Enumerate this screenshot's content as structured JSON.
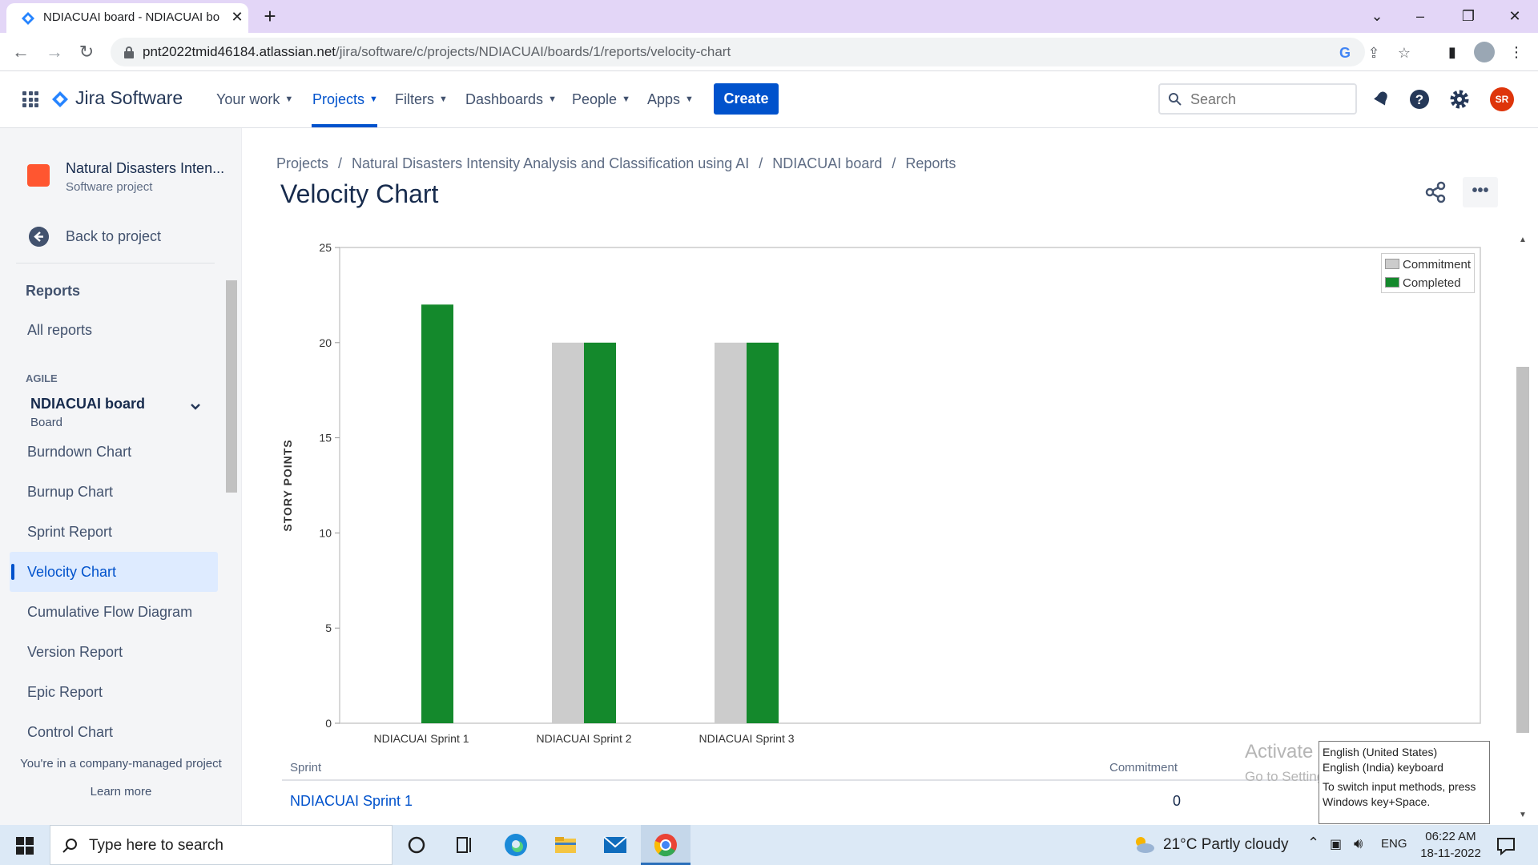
{
  "browser": {
    "tab_title": "NDIACUAI board - NDIACUAI bo",
    "url_host": "pnt2022tmid46184.atlassian.net",
    "url_path": "/jira/software/c/projects/NDIACUAI/boards/1/reports/velocity-chart"
  },
  "topnav": {
    "product": "Jira Software",
    "items": [
      {
        "label": "Your work"
      },
      {
        "label": "Projects"
      },
      {
        "label": "Filters"
      },
      {
        "label": "Dashboards"
      },
      {
        "label": "People"
      },
      {
        "label": "Apps"
      }
    ],
    "create_label": "Create",
    "search_placeholder": "Search",
    "avatar_initials": "SR"
  },
  "sidebar": {
    "project_name": "Natural Disasters Inten...",
    "project_type": "Software project",
    "back_label": "Back to project",
    "reports_heading": "Reports",
    "all_reports": "All reports",
    "agile_label": "AGILE",
    "board_name": "NDIACUAI board",
    "board_type": "Board",
    "links": [
      {
        "label": "Burndown Chart"
      },
      {
        "label": "Burnup Chart"
      },
      {
        "label": "Sprint Report"
      },
      {
        "label": "Velocity Chart"
      },
      {
        "label": "Cumulative Flow Diagram"
      },
      {
        "label": "Version Report"
      },
      {
        "label": "Epic Report"
      },
      {
        "label": "Control Chart"
      }
    ],
    "footer_text": "You're in a company-managed project",
    "learn_more": "Learn more"
  },
  "breadcrumb": [
    "Projects",
    "Natural Disasters Intensity Analysis and Classification using AI",
    "NDIACUAI board",
    "Reports"
  ],
  "page_title": "Velocity Chart",
  "chart_data": {
    "type": "bar",
    "ylabel": "STORY POINTS",
    "ylim": [
      0,
      25
    ],
    "yticks": [
      0,
      5,
      10,
      15,
      20,
      25
    ],
    "categories": [
      "NDIACUAI Sprint 1",
      "NDIACUAI Sprint 2",
      "NDIACUAI Sprint 3"
    ],
    "series": [
      {
        "name": "Commitment",
        "values": [
          0,
          20,
          20
        ],
        "color": "#cccccc"
      },
      {
        "name": "Completed",
        "values": [
          22,
          20,
          20
        ],
        "color": "#14892c"
      }
    ],
    "legend": "top-right",
    "grid": false
  },
  "table": {
    "headers": {
      "sprint": "Sprint",
      "commitment": "Commitment"
    },
    "rows": [
      {
        "sprint": "NDIACUAI Sprint 1",
        "commitment": "0"
      }
    ]
  },
  "windows": {
    "activate_title": "Activate Windows",
    "activate_sub": "Go to Settings to activate Windows.",
    "ime_tip": [
      "English (United States)",
      "English (India) keyboard",
      "To switch input methods, press",
      "Windows key+Space."
    ]
  },
  "taskbar": {
    "search_placeholder": "Type here to search",
    "weather": "21°C  Partly cloudy",
    "lang": "ENG",
    "time": "06:22 AM",
    "date": "18-11-2022"
  }
}
